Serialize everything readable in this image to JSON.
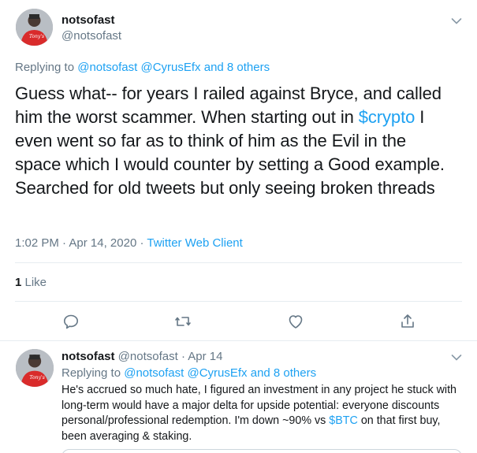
{
  "main_tweet": {
    "display_name": "notsofast",
    "handle": "@notsofast",
    "replying_prefix": "Replying to ",
    "replying_mentions": "@notsofast @CyrusEfx and 8 others",
    "text_part1": "Guess what-- for years I railed against Bryce, and called him the worst scammer. When starting out in ",
    "text_cashtag": "$crypto",
    "text_part2": " I even went so far as to think of him as the Evil in the space which I would counter by setting a Good example. Searched for old tweets but only seeing broken threads",
    "time": "1:02 PM",
    "date": "Apr 14, 2020",
    "client": "Twitter Web Client",
    "like_count": "1",
    "like_label": " Like"
  },
  "actions": {
    "icons": [
      "reply-icon",
      "retweet-icon",
      "like-icon",
      "share-icon"
    ]
  },
  "reply_tweet": {
    "display_name": "notsofast",
    "handle": "@notsofast",
    "date": "Apr 14",
    "replying_prefix": "Replying to ",
    "replying_mentions": "@notsofast @CyrusEfx and 8 others",
    "text_part1": "He's accrued so much hate, I figured an investment in any project he stuck with long-term would have a major delta for upside potential: everyone discounts personal/professional redemption. I'm down ~90% vs ",
    "text_cashtag": "$BTC",
    "text_part2": " on that first buy, been averaging & staking."
  },
  "colors": {
    "accent": "#1da1f2",
    "secondary_text": "#657786",
    "divider": "#e6ecf0"
  }
}
